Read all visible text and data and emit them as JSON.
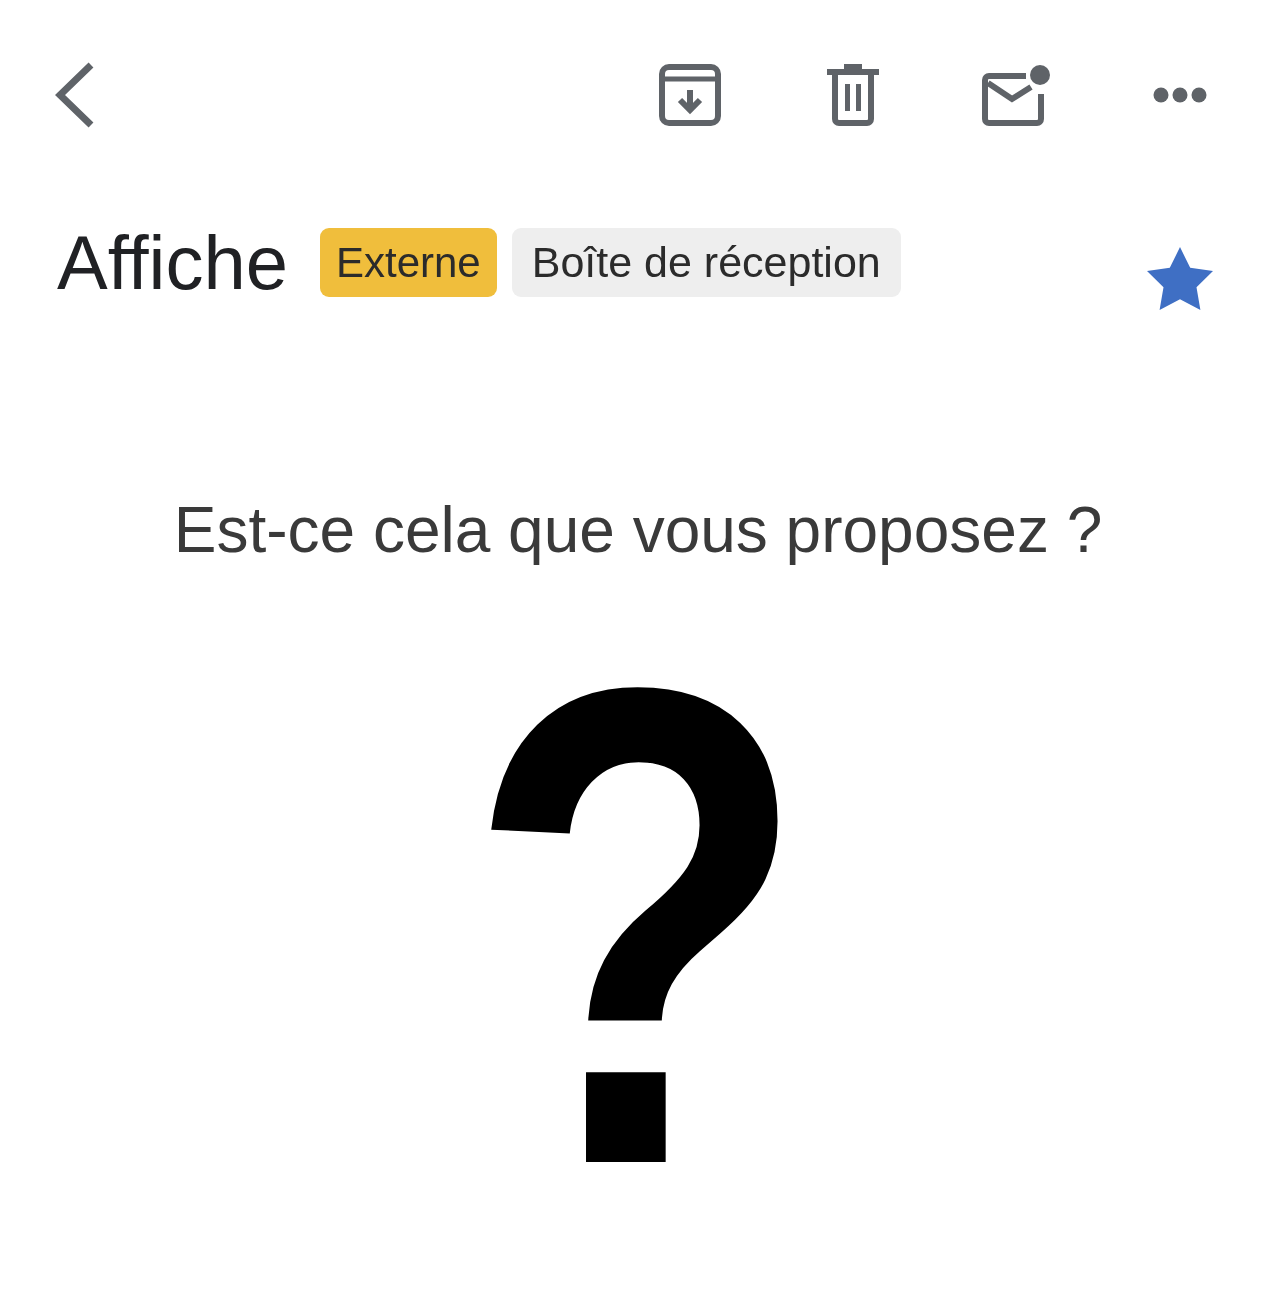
{
  "message": {
    "subject": "Affiche",
    "labels": [
      {
        "text": "Externe",
        "color": "#f0be3c"
      },
      {
        "text": "Boîte de réception",
        "color": "#eeeeee"
      }
    ],
    "starred": true
  },
  "body": {
    "text": "Est-ce cela que vous proposez ?",
    "symbol": "?"
  }
}
